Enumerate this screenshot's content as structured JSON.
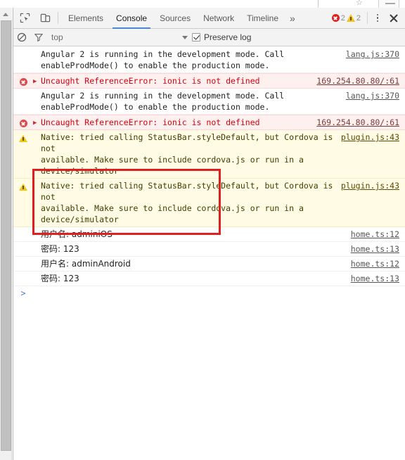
{
  "browser_chrome": {
    "star_icon": "star-icon",
    "minimize_icon": "minimize-icon"
  },
  "devtools": {
    "toolbar": {
      "inspect_icon": "inspect-element-icon",
      "device_toolbar_icon": "device-toolbar-icon",
      "tabs": [
        {
          "label": "Elements",
          "active": false
        },
        {
          "label": "Console",
          "active": true
        },
        {
          "label": "Sources",
          "active": false
        },
        {
          "label": "Network",
          "active": false
        },
        {
          "label": "Timeline",
          "active": false
        }
      ],
      "more_tabs_label": "»",
      "error_count": "2",
      "warning_count": "2",
      "error_icon": "error-circle-icon",
      "warning_icon": "warning-triangle-icon",
      "menu_icon": "kebab-menu-icon",
      "close_icon": "close-icon"
    },
    "filter_bar": {
      "clear_console_icon": "clear-console-icon",
      "filter_icon": "filter-funnel-icon",
      "context_value": "top",
      "context_caret_icon": "chevron-down-icon",
      "preserve_log_label": "Preserve log",
      "preserve_log_checked": true
    },
    "console": {
      "messages": [
        {
          "level": "log",
          "icon": "",
          "expander": false,
          "text": "Angular 2 is running in the development mode. Call\nenableProdMode() to enable the production mode.",
          "source": "lang.js:370"
        },
        {
          "level": "error",
          "icon": "error-circle-icon",
          "expander": true,
          "text": "Uncaught ReferenceError: ionic is not defined",
          "source": "169.254.80.80/:61"
        },
        {
          "level": "log",
          "icon": "",
          "expander": false,
          "text": "Angular 2 is running in the development mode. Call\nenableProdMode() to enable the production mode.",
          "source": "lang.js:370"
        },
        {
          "level": "error",
          "icon": "error-circle-icon",
          "expander": true,
          "text": "Uncaught ReferenceError: ionic is not defined",
          "source": "169.254.80.80/:61"
        },
        {
          "level": "warn",
          "icon": "warning-triangle-icon",
          "expander": false,
          "text": "Native: tried calling StatusBar.styleDefault, but Cordova is not\navailable. Make sure to include cordova.js or run in a device/simulator",
          "source": "plugin.js:43"
        },
        {
          "level": "warn",
          "icon": "warning-triangle-icon",
          "expander": false,
          "text": "Native: tried calling StatusBar.styleDefault, but Cordova is not\navailable. Make sure to include cordova.js or run in a device/simulator",
          "source": "plugin.js:43"
        },
        {
          "level": "log",
          "cjk": true,
          "icon": "",
          "expander": false,
          "text": "用户名: adminiOS",
          "source": "home.ts:12"
        },
        {
          "level": "log",
          "cjk": true,
          "icon": "",
          "expander": false,
          "text": "密码: 123",
          "source": "home.ts:13"
        },
        {
          "level": "log",
          "cjk": true,
          "icon": "",
          "expander": false,
          "text": "用户名: adminAndroid",
          "source": "home.ts:12"
        },
        {
          "level": "log",
          "cjk": true,
          "icon": "",
          "expander": false,
          "text": "密码: 123",
          "source": "home.ts:13"
        }
      ],
      "prompt_caret": ">"
    }
  },
  "annotation": {
    "color": "#e02020",
    "shape": "rectangle"
  },
  "page_scrollbar": {
    "up_arrow_icon": "scroll-up-arrow-icon"
  }
}
